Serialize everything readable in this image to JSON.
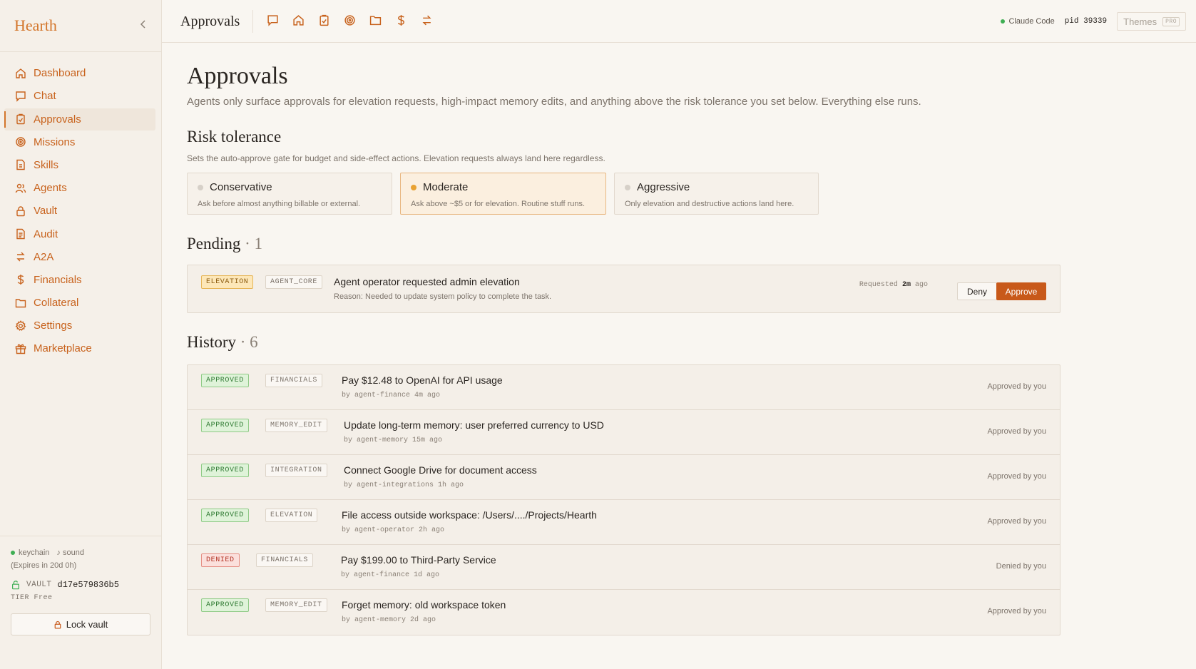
{
  "brand": "Hearth",
  "sidebar": {
    "items": [
      {
        "label": "Dashboard",
        "icon": "home-icon"
      },
      {
        "label": "Chat",
        "icon": "chat-icon"
      },
      {
        "label": "Approvals",
        "icon": "clipboard-check-icon",
        "active": true
      },
      {
        "label": "Missions",
        "icon": "target-icon"
      },
      {
        "label": "Skills",
        "icon": "document-icon"
      },
      {
        "label": "Agents",
        "icon": "users-icon"
      },
      {
        "label": "Vault",
        "icon": "lock-icon"
      },
      {
        "label": "Audit",
        "icon": "file-text-icon"
      },
      {
        "label": "A2A",
        "icon": "arrows-exchange-icon"
      },
      {
        "label": "Financials",
        "icon": "dollar-icon"
      },
      {
        "label": "Collateral",
        "icon": "folder-icon"
      },
      {
        "label": "Settings",
        "icon": "gear-icon"
      },
      {
        "label": "Marketplace",
        "icon": "gift-icon"
      }
    ],
    "footer": {
      "keychain": "keychain",
      "sound": "sound",
      "expires": "(Expires in 20d 0h)",
      "vault_label": "VAULT",
      "vault_id": "d17e579836b5",
      "tier_label": "TIER",
      "tier_value": "Free",
      "lock_label": "Lock vault"
    }
  },
  "topbar": {
    "title": "Approvals",
    "status_label": "Claude Code",
    "pid_label": "pid",
    "pid_value": "39339",
    "themes_label": "Themes",
    "pro_badge": "PRO"
  },
  "page": {
    "title": "Approvals",
    "intro": "Agents only surface approvals for elevation requests, high-impact memory edits, and anything above the risk tolerance you set below. Everything else runs."
  },
  "risk": {
    "title": "Risk tolerance",
    "desc": "Sets the auto-approve gate for budget and side-effect actions. Elevation requests always land here regardless.",
    "options": [
      {
        "name": "Conservative",
        "desc": "Ask before almost anything billable or external."
      },
      {
        "name": "Moderate",
        "desc": "Ask above ~$5 or for elevation. Routine stuff runs.",
        "selected": true
      },
      {
        "name": "Aggressive",
        "desc": "Only elevation and destructive actions land here."
      }
    ]
  },
  "pending": {
    "title": "Pending",
    "count": "· 1",
    "item": {
      "tag": "ELEVATION",
      "source": "AGENT_CORE",
      "title": "Agent operator requested admin elevation",
      "reason": "Reason: Needed to update system policy to complete the task.",
      "requested_label": "Requested",
      "requested_time": "2m",
      "requested_suffix": "ago",
      "deny_label": "Deny",
      "approve_label": "Approve"
    }
  },
  "history": {
    "title": "History",
    "count": "· 6",
    "items": [
      {
        "status": "APPROVED",
        "category": "FINANCIALS",
        "title": "Pay $12.48 to OpenAI for API usage",
        "meta": "by agent-finance  4m ago",
        "outcome": "Approved by you"
      },
      {
        "status": "APPROVED",
        "category": "MEMORY_EDIT",
        "title": "Update long-term memory: user preferred currency to USD",
        "meta": "by agent-memory  15m ago",
        "outcome": "Approved by you"
      },
      {
        "status": "APPROVED",
        "category": "INTEGRATION",
        "title": "Connect Google Drive for document access",
        "meta": "by agent-integrations  1h ago",
        "outcome": "Approved by you"
      },
      {
        "status": "APPROVED",
        "category": "ELEVATION",
        "title": "File access outside workspace: /Users/..../Projects/Hearth",
        "meta": "by agent-operator  2h ago",
        "outcome": "Approved by you"
      },
      {
        "status": "DENIED",
        "category": "FINANCIALS",
        "title": "Pay $199.00 to Third-Party Service",
        "meta": "by agent-finance  1d ago",
        "outcome": "Denied by you"
      },
      {
        "status": "APPROVED",
        "category": "MEMORY_EDIT",
        "title": "Forget memory: old workspace token",
        "meta": "by agent-memory  2d ago",
        "outcome": "Approved by you"
      }
    ]
  },
  "colors": {
    "accent": "#c8621c",
    "approve": "#c8591a",
    "approved_green": "#2f7a32",
    "denied_red": "#b23324"
  }
}
